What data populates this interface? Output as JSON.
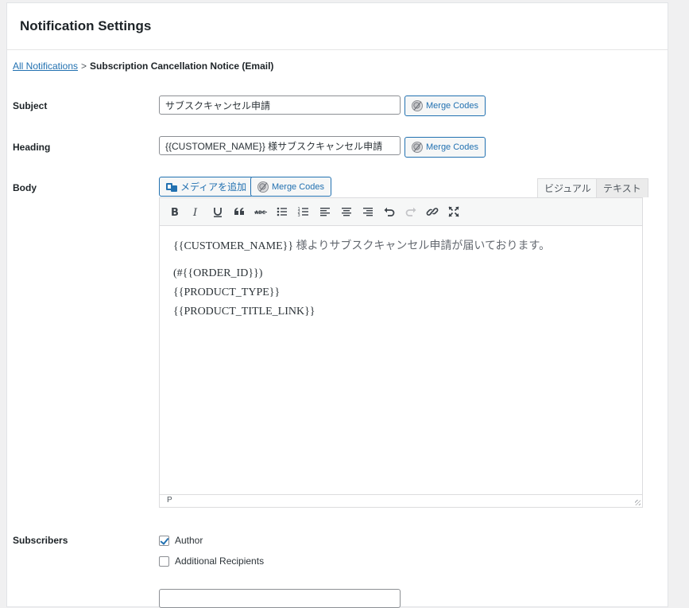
{
  "header": {
    "title": "Notification Settings"
  },
  "breadcrumb": {
    "link": "All Notifications",
    "separator": ">",
    "current": "Subscription Cancellation Notice (Email)"
  },
  "subject": {
    "label": "Subject",
    "value": "サブスクキャンセル申請",
    "merge_label": "Merge Codes"
  },
  "heading": {
    "label": "Heading",
    "value": "{{CUSTOMER_NAME}} 様サブスクキャンセル申請",
    "merge_label": "Merge Codes"
  },
  "body": {
    "label": "Body",
    "add_media_label": "メディアを追加",
    "merge_label": "Merge Codes",
    "tabs": {
      "visual": "ビジュアル",
      "text": "テキスト"
    },
    "toolbar": [
      "bold",
      "italic",
      "underline",
      "blockquote",
      "strikethrough",
      "bullet-list",
      "numbered-list",
      "align-left",
      "align-center",
      "align-right",
      "undo",
      "redo",
      "link",
      "fullscreen"
    ],
    "content": {
      "line1_code": "{{CUSTOMER_NAME}}",
      "line1_text": " 様よりサブスクキャンセル申請が届いております。",
      "line2": "(#{{ORDER_ID}})",
      "line3": "{{PRODUCT_TYPE}}",
      "line4": "{{PRODUCT_TITLE_LINK}}"
    },
    "status_path": "P"
  },
  "subscribers": {
    "label": "Subscribers",
    "options": [
      {
        "label": "Author",
        "checked": true
      },
      {
        "label": "Additional Recipients",
        "checked": false
      }
    ]
  },
  "colors": {
    "accent": "#2271b1",
    "border": "#8c8f94"
  }
}
